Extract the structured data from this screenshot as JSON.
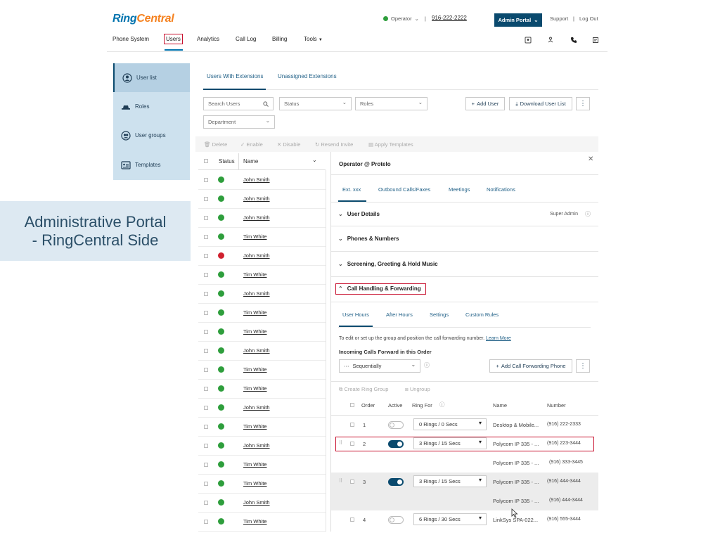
{
  "brand": {
    "ring": "Ring",
    "central": "Central",
    "ring_color": "#0073ae",
    "central_color": "#f58220"
  },
  "header": {
    "status": "Operator",
    "phone": "916-222-2222",
    "admin_portal": "Admin Portal",
    "support": "Support",
    "sep": "|",
    "logout": "Log Out"
  },
  "nav": {
    "items": [
      "Phone System",
      "Users",
      "Analytics",
      "Call Log",
      "Billing",
      "Tools"
    ],
    "active": "Users"
  },
  "sidebar": {
    "items": [
      {
        "label": "User list",
        "icon": "user-list-icon"
      },
      {
        "label": "Roles",
        "icon": "hat-icon"
      },
      {
        "label": "User groups",
        "icon": "user-groups-icon"
      },
      {
        "label": "Templates",
        "icon": "templates-icon"
      }
    ]
  },
  "banner": {
    "line1": "Administrative Portal",
    "line2": "- RingCentral Side"
  },
  "main": {
    "tabs": [
      "Users With Extensions",
      "Unassigned Extensions"
    ],
    "search_placeholder": "Search Users",
    "status_filter": "Status",
    "roles_filter": "Roles",
    "department_filter": "Department",
    "add_user": "Add User",
    "download_list": "Download User List",
    "toolbar": [
      "Delete",
      "Enable",
      "Disable",
      "Resend Invite",
      "Apply Templates"
    ],
    "table": {
      "col_status": "Status",
      "col_name": "Name",
      "rows": [
        {
          "name": "John Smith",
          "status": "ok"
        },
        {
          "name": "John Smith",
          "status": "ok"
        },
        {
          "name": "John Smith",
          "status": "ok"
        },
        {
          "name": "Tim White",
          "status": "ok"
        },
        {
          "name": "John Smith",
          "status": "err"
        },
        {
          "name": "Tim White",
          "status": "ok"
        },
        {
          "name": "John Smith",
          "status": "ok"
        },
        {
          "name": "Tim White",
          "status": "ok"
        },
        {
          "name": "Tim White",
          "status": "ok"
        },
        {
          "name": "John Smith",
          "status": "ok"
        },
        {
          "name": "Tim White",
          "status": "ok"
        },
        {
          "name": "Tim White",
          "status": "ok"
        },
        {
          "name": "John Smith",
          "status": "ok"
        },
        {
          "name": "Tim White",
          "status": "ok"
        },
        {
          "name": "John Smith",
          "status": "ok"
        },
        {
          "name": "Tim White",
          "status": "ok"
        },
        {
          "name": "Tim White",
          "status": "ok"
        },
        {
          "name": "John Smith",
          "status": "ok"
        },
        {
          "name": "Tim White",
          "status": "ok"
        }
      ]
    }
  },
  "detail": {
    "title": "Operator @ Protelo",
    "tabs": [
      "Ext. xxx",
      "Outbound Calls/Faxes",
      "Meetings",
      "Notifications"
    ],
    "sections": {
      "user_details": "User Details",
      "super_admin": "Super Admin",
      "phones": "Phones & Numbers",
      "screening": "Screening, Greeting & Hold Music",
      "call_handling": "Call Handling & Forwarding"
    },
    "sub_tabs": [
      "User Hours",
      "After Hours",
      "Settings",
      "Custom Rules"
    ],
    "note": "To edit or set up the group and position the call forwarding number.",
    "learn_more": "Learn More",
    "incoming": "Incoming Calls Forward in this Order",
    "mode": "Sequentially",
    "add_forwarding": "Add Call Forwarding Phone",
    "create_ring_group": "Create Ring Group",
    "ungroup": "Ungroup",
    "cols": {
      "order": "Order",
      "active": "Active",
      "ring_for": "Ring For",
      "name": "Name",
      "number": "Number"
    },
    "rows": [
      {
        "order": "1",
        "active": false,
        "ring": "0 Rings / 0 Secs",
        "name": "Desktop & Mobile...",
        "number": "(916) 222-2333"
      },
      {
        "order": "2",
        "active": true,
        "ring": "3 Rings / 15 Secs",
        "name": "Polycom IP 335 - ...",
        "number": "(916) 223-3444"
      },
      {
        "order": "",
        "active": null,
        "ring": "",
        "name": "Polycom IP 335 - ...",
        "number": "(916) 333-3445"
      },
      {
        "order": "3",
        "active": true,
        "ring": "3 Rings / 15 Secs",
        "name": "Polycom IP 335 - ...",
        "number": "(916) 444-3444"
      },
      {
        "order": "",
        "active": null,
        "ring": "",
        "name": "Polycom IP 335 - ...",
        "number": "(916) 444-3444"
      },
      {
        "order": "4",
        "active": false,
        "ring": "6 Rings / 30 Secs",
        "name": "LinkSys SPA-022...",
        "number": "(916) 555-3444"
      }
    ]
  }
}
